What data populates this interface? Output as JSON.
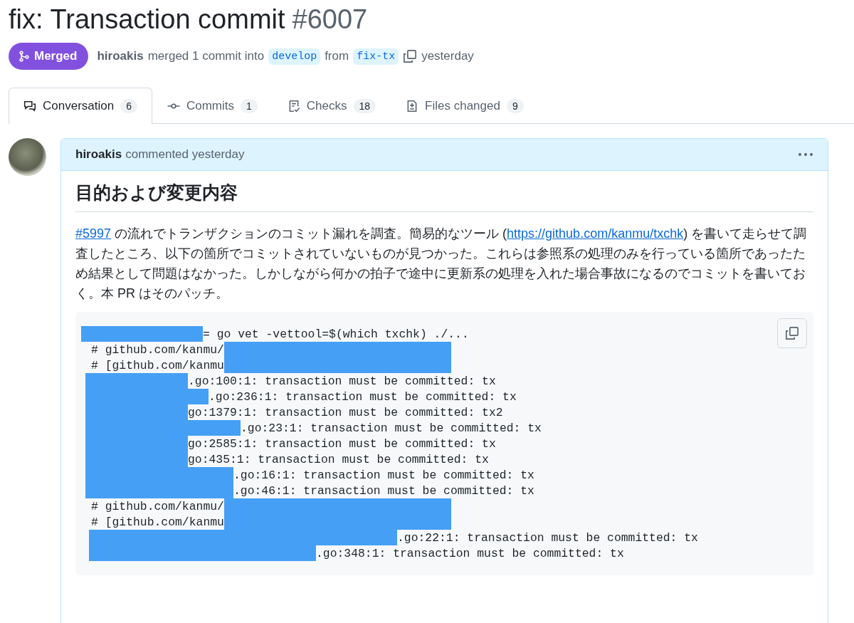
{
  "title": {
    "text": "fix: Transaction commit",
    "number": "#6007"
  },
  "status": {
    "label": "Merged"
  },
  "merge_info": {
    "author": "hiroakis",
    "action": "merged 1 commit into",
    "base": "develop",
    "from": "from",
    "head": "fix-tx",
    "time": "yesterday"
  },
  "tabs": [
    {
      "label": "Conversation",
      "count": "6",
      "selected": true
    },
    {
      "label": "Commits",
      "count": "1",
      "selected": false
    },
    {
      "label": "Checks",
      "count": "18",
      "selected": false
    },
    {
      "label": "Files changed",
      "count": "9",
      "selected": false
    }
  ],
  "comment": {
    "author": "hiroakis",
    "action": "commented yesterday",
    "heading": "目的および変更内容",
    "paragraph": [
      {
        "kind": "link",
        "text": "#5997"
      },
      {
        "kind": "text",
        "text": " の流れでトランザクションのコミット漏れを調査。簡易的なツール ("
      },
      {
        "kind": "link",
        "text": "https://github.com/kanmu/txchk"
      },
      {
        "kind": "text",
        "text": ") を書いて走らせて調査したところ、以下の箇所でコミットされていないものが見つかった。これらは参照系の処理のみを行っている箇所であったため結果として問題はなかった。しかしながら何かの拍子で途中に更新系の処理を入れた場合事故になるのでコミットを書いておく。本 PR はそのパッチ。"
      }
    ],
    "code_lines": [
      [
        {
          "kind": "redacted"
        },
        {
          "kind": "text",
          "text": "= go vet -vettool=$(which txchk) ./..."
        }
      ],
      [
        {
          "kind": "text",
          "text": "# github.com/kanmu/"
        },
        {
          "kind": "redacted"
        }
      ],
      [
        {
          "kind": "text",
          "text": "# [github.com/kanmu"
        },
        {
          "kind": "redacted"
        }
      ],
      [
        {
          "kind": "redacted"
        },
        {
          "kind": "text",
          "text": ".go:100:1: transaction must be committed: tx"
        }
      ],
      [
        {
          "kind": "redacted"
        },
        {
          "kind": "text",
          "text": ".go:236:1: transaction must be committed: tx"
        }
      ],
      [
        {
          "kind": "redacted"
        },
        {
          "kind": "text",
          "text": "go:1379:1: transaction must be committed: tx2"
        }
      ],
      [
        {
          "kind": "redacted"
        },
        {
          "kind": "text",
          "text": ".go:23:1: transaction must be committed: tx"
        }
      ],
      [
        {
          "kind": "redacted"
        },
        {
          "kind": "text",
          "text": "go:2585:1: transaction must be committed: tx"
        }
      ],
      [
        {
          "kind": "redacted"
        },
        {
          "kind": "text",
          "text": "go:435:1: transaction must be committed: tx"
        }
      ],
      [
        {
          "kind": "redacted"
        },
        {
          "kind": "text",
          "text": ".go:16:1: transaction must be committed: tx"
        }
      ],
      [
        {
          "kind": "redacted"
        },
        {
          "kind": "text",
          "text": ".go:46:1: transaction must be committed: tx"
        }
      ],
      [
        {
          "kind": "text",
          "text": "# github.com/kanmu/"
        },
        {
          "kind": "redacted"
        }
      ],
      [
        {
          "kind": "text",
          "text": "# [github.com/kanmu"
        },
        {
          "kind": "redacted"
        }
      ],
      [
        {
          "kind": "redacted"
        },
        {
          "kind": "text",
          "text": ".go:22:1: transaction must be committed: tx"
        }
      ],
      [
        {
          "kind": "redacted"
        },
        {
          "kind": "text",
          "text": ".go:348:1: transaction must be committed: tx"
        }
      ]
    ]
  }
}
